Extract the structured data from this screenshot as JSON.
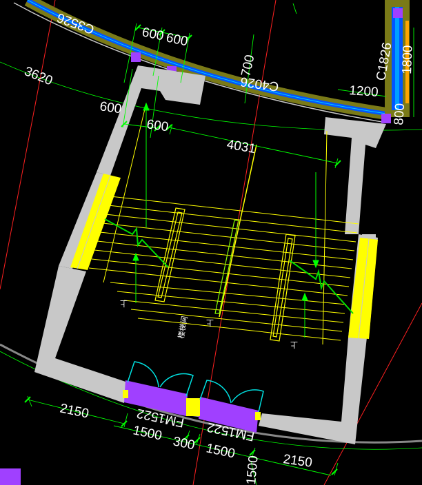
{
  "drawing": {
    "window_label_top_left": "C3526",
    "window_label_top": "C4026",
    "window_label_right": "C1826",
    "door_label_left": "FM1522",
    "door_label_right": "FM1522",
    "room_label": "楼梯间",
    "up_mark": "上"
  },
  "dimensions": {
    "d600a": "600",
    "d600b": "600",
    "d3620": "3620",
    "d600c": "600",
    "d600d": "600",
    "d4031": "4031",
    "d700": "700",
    "d1200": "1200",
    "d1800": "1800",
    "d800": "800",
    "d2150a": "2150",
    "d1500a": "1500",
    "d300": "300",
    "d1500b": "1500",
    "d2150b": "2150",
    "d1500c": "1500"
  },
  "colors": {
    "wall": "#c8c8c8",
    "dimension_line": "#00ff00",
    "stair": "#ffff00",
    "window": "#0055ff",
    "door_swing": "#00e0e0",
    "door_fill": "#a040ff",
    "axis": "#ff2020",
    "arc_band": "#7a7a18"
  }
}
